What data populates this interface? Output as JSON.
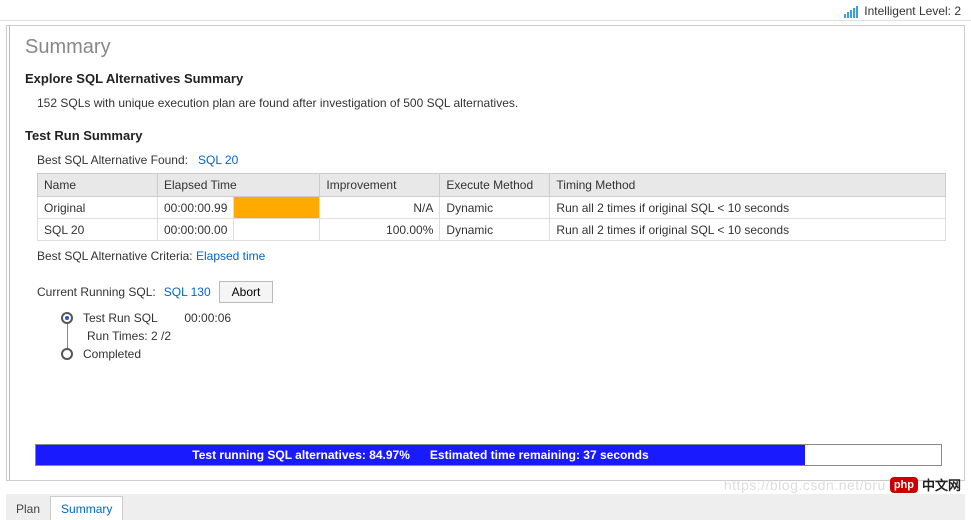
{
  "topbar": {
    "intelligent_level_label": "Intelligent Level: 2"
  },
  "page_title": "Summary",
  "explore": {
    "heading": "Explore SQL Alternatives Summary",
    "body": "152 SQLs with unique execution plan are found after investigation of 500 SQL alternatives."
  },
  "testrun": {
    "heading": "Test Run Summary",
    "best_found_label": "Best SQL Alternative Found:",
    "best_found_value": "SQL 20",
    "table": {
      "headers": {
        "name": "Name",
        "elapsed": "Elapsed Time",
        "improvement": "Improvement",
        "execute_method": "Execute Method",
        "timing_method": "Timing Method"
      },
      "rows": [
        {
          "name": "Original",
          "elapsed": "00:00:00.99",
          "bar_pct": 60,
          "improvement": "N/A",
          "execute_method": "Dynamic",
          "timing_method": "Run all 2 times if original SQL < 10 seconds"
        },
        {
          "name": "SQL 20",
          "elapsed": "00:00:00.00",
          "bar_pct": 0,
          "improvement": "100.00%",
          "execute_method": "Dynamic",
          "timing_method": "Run all 2 times if original SQL < 10 seconds"
        }
      ]
    },
    "criteria_label": "Best SQL Alternative Criteria:",
    "criteria_value": "Elapsed time",
    "current_running_label": "Current Running SQL:",
    "current_running_value": "SQL 130",
    "abort_label": "Abort",
    "timeline": {
      "test_run_label": "Test Run SQL",
      "test_run_time": "00:00:06",
      "run_times_label": "Run Times: 2 /2",
      "completed_label": "Completed"
    },
    "progress": {
      "percent": 84.97,
      "text_left": "Test running SQL alternatives: 84.97%",
      "text_right": "Estimated time remaining: 37 seconds"
    }
  },
  "tabs": {
    "plan": "Plan",
    "summary": "Summary"
  },
  "watermark": {
    "url": "https://blog.csdn.net/bru",
    "badge": "php",
    "cn": "中文网"
  }
}
